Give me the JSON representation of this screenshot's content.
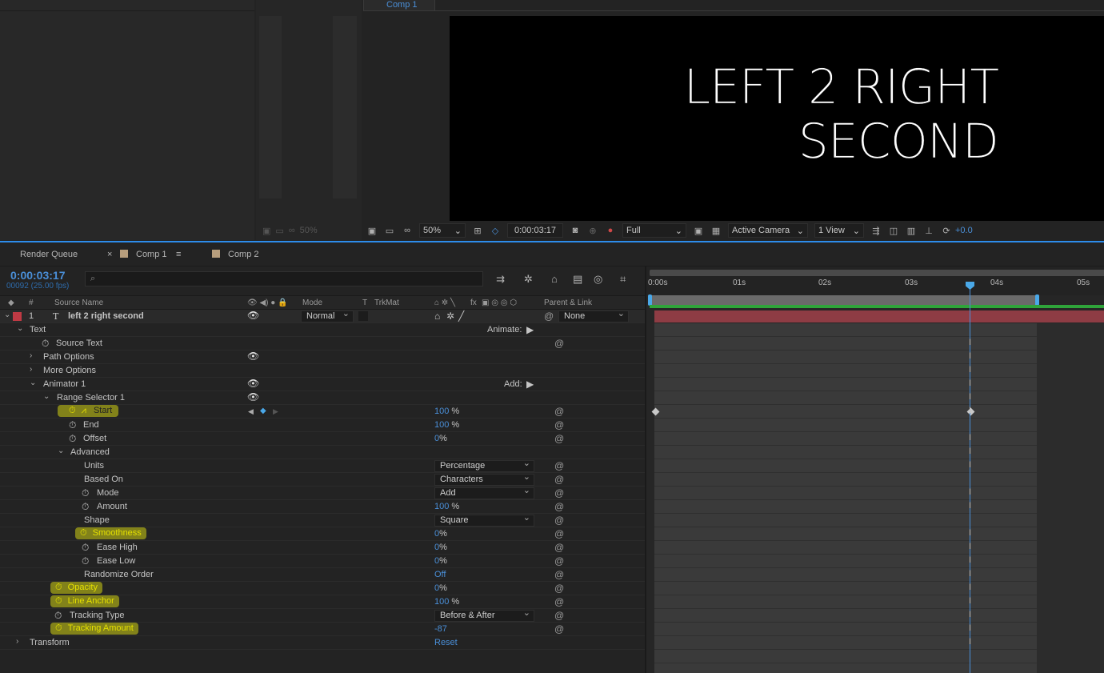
{
  "viewer": {
    "tab": "Comp 1",
    "text_line1": "LEFT 2 RIGHT",
    "text_line2": "SECOND",
    "mid_zoom": "50%",
    "zoom": "50%",
    "timecode": "0:00:03:17",
    "resolution": "Full",
    "camera": "Active Camera",
    "views": "1 View",
    "exposure": "+0.0"
  },
  "tabs": {
    "render_queue": "Render Queue",
    "close_glyph": "×",
    "comp1": "Comp 1",
    "menu_glyph": "≡",
    "comp2": "Comp 2"
  },
  "timeline": {
    "time": "0:00:03:17",
    "frames": "00092 (25.00 fps)",
    "search_icon": "⌕",
    "columns": {
      "hash": "#",
      "source_name": "Source Name",
      "mode": "Mode",
      "t": "T",
      "trkmat": "TrkMat",
      "fx": "fx",
      "parent": "Parent & Link"
    },
    "layer": {
      "index": "1",
      "type_icon": "T",
      "name": "left 2 right second",
      "mode": "Normal",
      "parent": "None"
    },
    "props": {
      "text": "Text",
      "animate": "Animate:",
      "source_text": "Source Text",
      "path_options": "Path Options",
      "more_options": "More Options",
      "animator1": "Animator 1",
      "add": "Add:",
      "range_selector": "Range Selector 1",
      "start": "Start",
      "start_val": "100",
      "end": "End",
      "end_val": "100",
      "offset": "Offset",
      "offset_val": "0",
      "advanced": "Advanced",
      "units": "Units",
      "units_val": "Percentage",
      "based_on": "Based On",
      "based_on_val": "Characters",
      "mode": "Mode",
      "mode_val": "Add",
      "amount": "Amount",
      "amount_val": "100",
      "shape": "Shape",
      "shape_val": "Square",
      "smoothness": "Smoothness",
      "smoothness_val": "0",
      "ease_high": "Ease High",
      "ease_high_val": "0",
      "ease_low": "Ease Low",
      "ease_low_val": "0",
      "randomize": "Randomize Order",
      "randomize_val": "Off",
      "opacity": "Opacity",
      "opacity_val": "0",
      "line_anchor": "Line Anchor",
      "line_anchor_val": "100",
      "tracking_type": "Tracking Type",
      "tracking_type_val": "Before & After",
      "tracking_amount": "Tracking Amount",
      "tracking_amount_val": "-87",
      "transform": "Transform",
      "reset": "Reset",
      "pct": "%"
    },
    "ruler": [
      "0:00s",
      "01s",
      "02s",
      "03s",
      "04s",
      "05s"
    ]
  }
}
